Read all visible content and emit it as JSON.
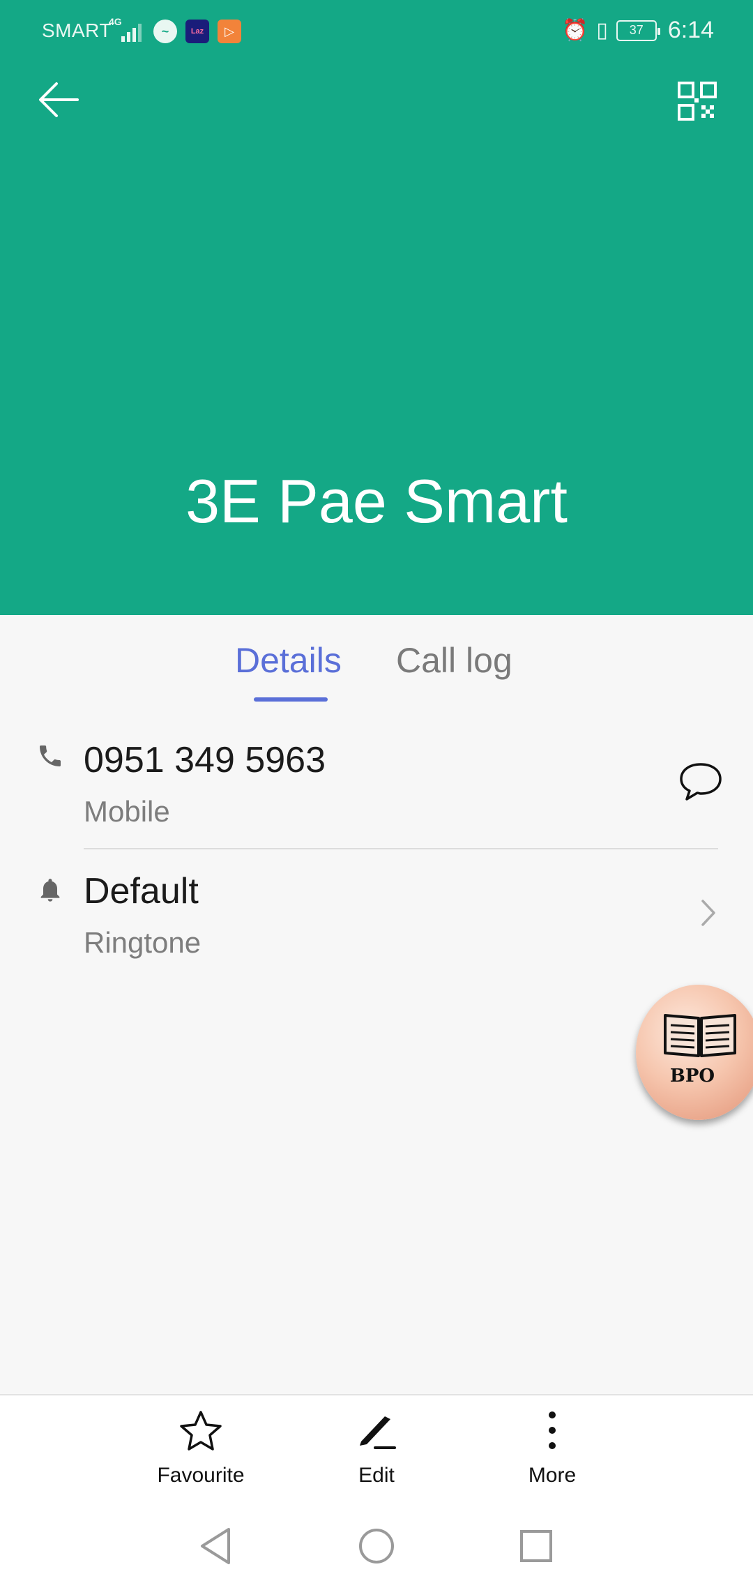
{
  "status_bar": {
    "carrier": "SMART",
    "network_type": "4G",
    "notification_icons": [
      {
        "name": "messenger-icon",
        "glyph": "~"
      },
      {
        "name": "lazada-icon",
        "glyph": "Laz"
      },
      {
        "name": "play-icon",
        "glyph": "▷"
      }
    ],
    "alarm_icon": "⏰",
    "vibrate_icon": "▯",
    "battery_level": "37",
    "time": "6:14"
  },
  "header": {
    "background_color": "#14a886",
    "contact_name": "3E Pae Smart",
    "back_icon": "arrow-left-icon",
    "qr_icon": "qr-code-icon"
  },
  "tabs": [
    {
      "label": "Details",
      "active": true
    },
    {
      "label": "Call log",
      "active": false
    }
  ],
  "accent_color": "#5a6fd8",
  "details": {
    "phone": {
      "number": "0951 349 5963",
      "type": "Mobile",
      "icon": "phone-icon",
      "action_icon": "message-icon"
    },
    "ringtone": {
      "value": "Default",
      "label": "Ringtone",
      "icon": "bell-icon",
      "action_icon": "chevron-right-icon"
    }
  },
  "floating_bubble": {
    "label": "BPO",
    "icon": "book-icon"
  },
  "actions": [
    {
      "label": "Favourite",
      "icon": "star-icon"
    },
    {
      "label": "Edit",
      "icon": "pencil-icon"
    },
    {
      "label": "More",
      "icon": "more-vertical-icon"
    }
  ],
  "nav_bar": {
    "back": "nav-back-icon",
    "home": "nav-home-icon",
    "recents": "nav-recents-icon"
  }
}
